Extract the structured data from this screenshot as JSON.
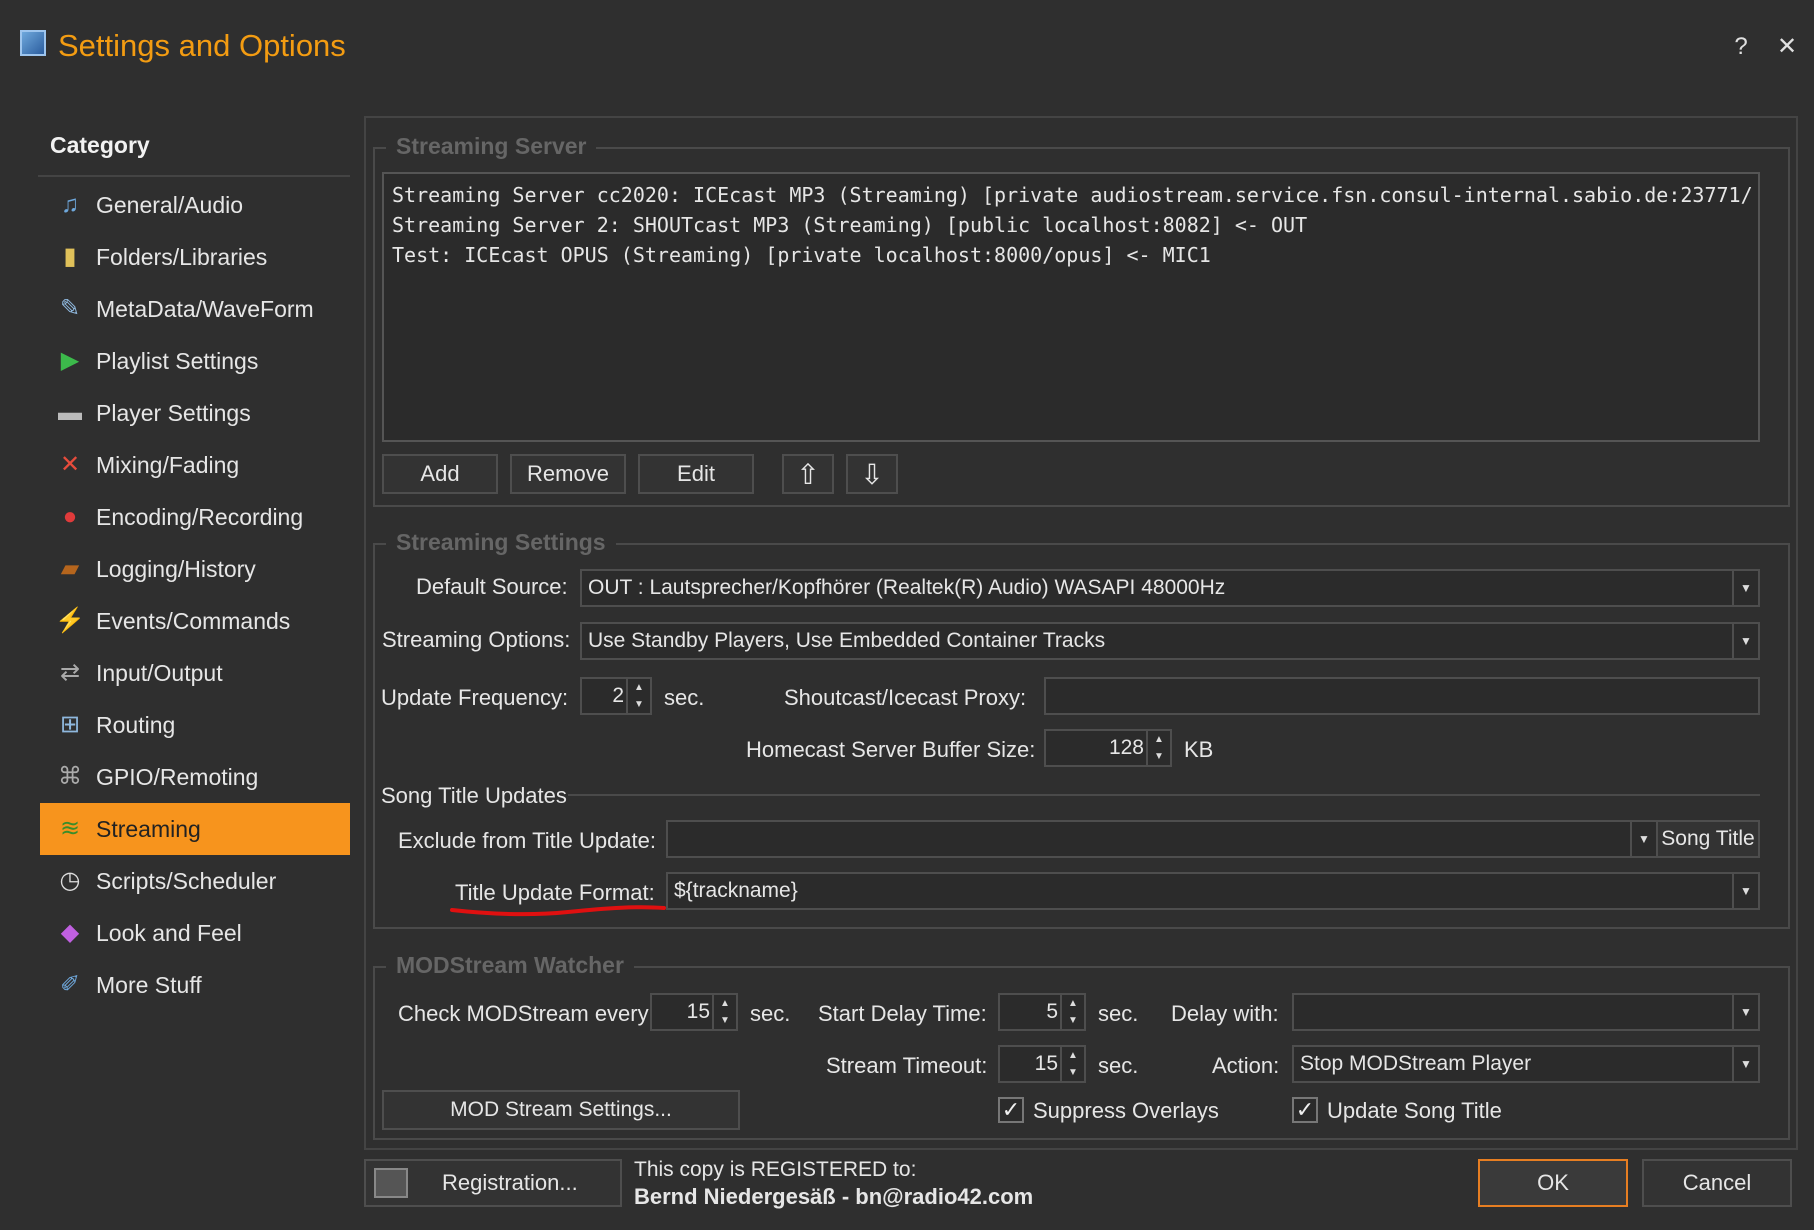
{
  "window": {
    "title": "Settings and Options",
    "help_label": "?",
    "close_label": "✕"
  },
  "sidebar": {
    "title": "Category",
    "items": [
      {
        "label": "General/Audio",
        "icon": "music-note-icon",
        "glyph": "♫",
        "color": "#6fa8dc"
      },
      {
        "label": "Folders/Libraries",
        "icon": "folder-icon",
        "glyph": "▮",
        "color": "#e0c15a"
      },
      {
        "label": "MetaData/WaveForm",
        "icon": "metadata-icon",
        "glyph": "✎",
        "color": "#8fb8de"
      },
      {
        "label": "Playlist Settings",
        "icon": "playlist-icon",
        "glyph": "▶",
        "color": "#3cba4b"
      },
      {
        "label": "Player Settings",
        "icon": "player-icon",
        "glyph": "▬",
        "color": "#bbbbbb"
      },
      {
        "label": "Mixing/Fading",
        "icon": "mixing-icon",
        "glyph": "✕",
        "color": "#e74c3c"
      },
      {
        "label": "Encoding/Recording",
        "icon": "record-icon",
        "glyph": "●",
        "color": "#e03b3b"
      },
      {
        "label": "Logging/History",
        "icon": "log-icon",
        "glyph": "▰",
        "color": "#b5651d"
      },
      {
        "label": "Events/Commands",
        "icon": "lightning-icon",
        "glyph": "⚡",
        "color": "#f1c40f"
      },
      {
        "label": "Input/Output",
        "icon": "input-output-icon",
        "glyph": "⇄",
        "color": "#aaaaaa"
      },
      {
        "label": "Routing",
        "icon": "routing-icon",
        "glyph": "⊞",
        "color": "#8fb8de"
      },
      {
        "label": "GPIO/Remoting",
        "icon": "gpio-icon",
        "glyph": "⌘",
        "color": "#aaaaaa"
      },
      {
        "label": "Streaming",
        "icon": "streaming-icon",
        "glyph": "≋",
        "color": "#3a8d2a"
      },
      {
        "label": "Scripts/Scheduler",
        "icon": "clock-icon",
        "glyph": "◷",
        "color": "#dddddd"
      },
      {
        "label": "Look and Feel",
        "icon": "palette-icon",
        "glyph": "◆",
        "color": "#c060e0"
      },
      {
        "label": "More Stuff",
        "icon": "more-stuff-icon",
        "glyph": "✐",
        "color": "#6fa8dc"
      }
    ]
  },
  "streaming_server": {
    "legend": "Streaming Server",
    "list": [
      "Streaming Server cc2020: ICEcast MP3 (Streaming) [private audiostream.service.fsn.consul-internal.sabio.de:23771/",
      "Streaming Server 2: SHOUTcast MP3 (Streaming) [public localhost:8082] <- OUT",
      "Test: ICEcast OPUS (Streaming) [private localhost:8000/opus] <- MIC1"
    ],
    "buttons": {
      "add": "Add",
      "remove": "Remove",
      "edit": "Edit",
      "up": "⇧",
      "down": "⇩"
    }
  },
  "streaming_settings": {
    "legend": "Streaming Settings",
    "default_source_label": "Default Source:",
    "default_source_value": "OUT  : Lautsprecher/Kopfhörer (Realtek(R) Audio) WASAPI 48000Hz",
    "streaming_options_label": "Streaming Options:",
    "streaming_options_value": "Use Standby Players, Use Embedded Container Tracks",
    "update_frequency_label": "Update Frequency:",
    "update_frequency_value": "2",
    "update_frequency_unit": "sec.",
    "proxy_label": "Shoutcast/Icecast Proxy:",
    "proxy_value": "",
    "buffer_label": "Homecast Server Buffer Size:",
    "buffer_value": "128",
    "buffer_unit": "KB",
    "song_title_updates_label": "Song Title Updates",
    "exclude_label": "Exclude from Title Update:",
    "exclude_value": "",
    "exclude_button": "Song Title",
    "format_label": "Title Update Format:",
    "format_value": "${trackname}",
    "annotation_color": "#e01010"
  },
  "modstream": {
    "legend": "MODStream Watcher",
    "check_label": "Check MODStream every:",
    "check_value": "15",
    "check_unit": "sec.",
    "start_delay_label": "Start Delay Time:",
    "start_delay_value": "5",
    "start_delay_unit": "sec.",
    "delay_with_label": "Delay with:",
    "delay_with_value": "",
    "timeout_label": "Stream Timeout:",
    "timeout_value": "15",
    "timeout_unit": "sec.",
    "action_label": "Action:",
    "action_value": "Stop MODStream Player",
    "settings_button": "MOD Stream Settings...",
    "suppress_overlays_label": "Suppress Overlays",
    "suppress_overlays_checked": true,
    "update_song_title_label": "Update Song Title",
    "update_song_title_checked": true
  },
  "footer": {
    "registration_button": "Registration...",
    "registered_line": "This copy is REGISTERED to:",
    "registered_to": "Bernd Niedergesäß - bn@radio42.com",
    "ok_button": "OK",
    "cancel_button": "Cancel",
    "ok_border_color": "#e67e22"
  },
  "colors": {
    "accent": "#f7941d",
    "title": "#f39c12",
    "background": "#2f2f2f"
  }
}
